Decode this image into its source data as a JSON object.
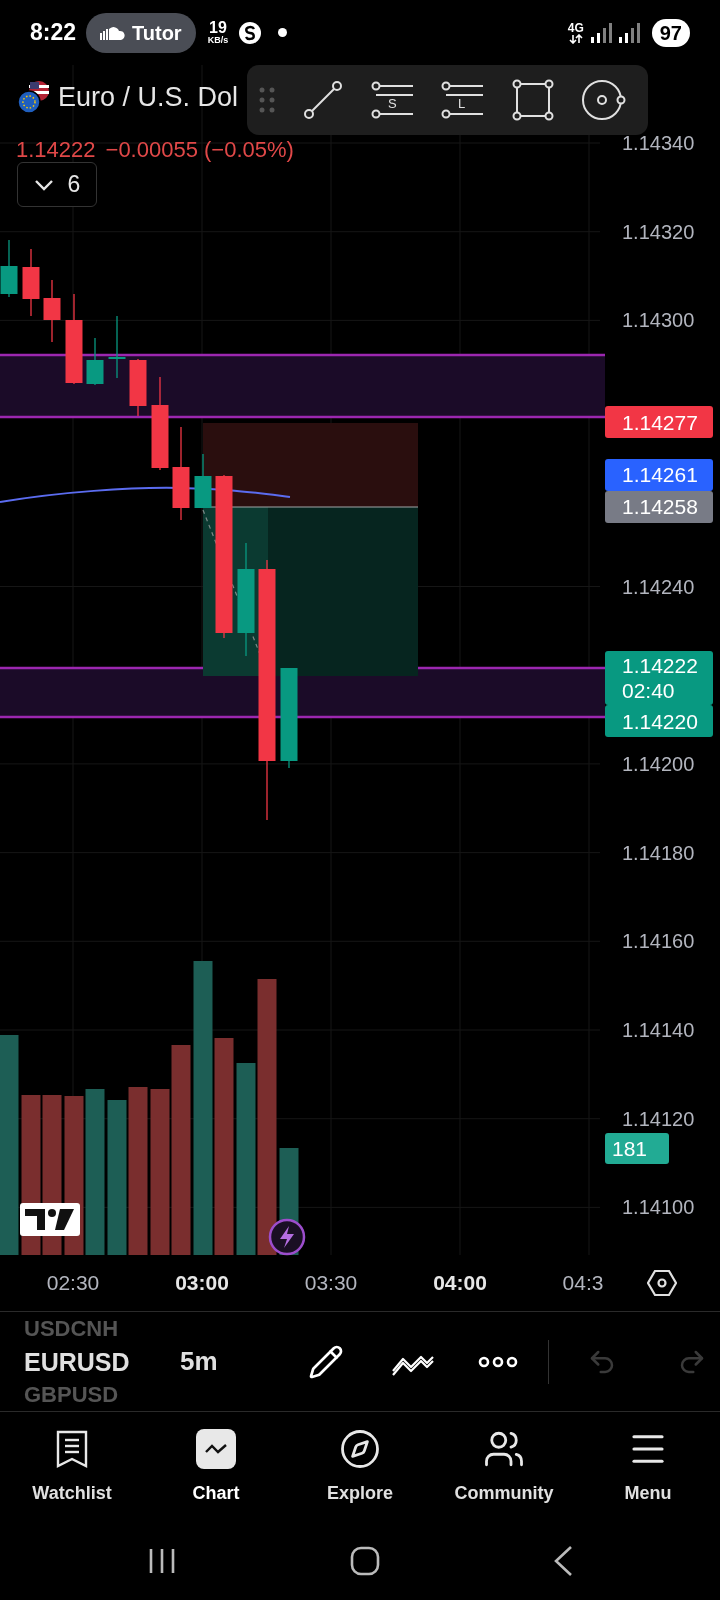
{
  "status_bar": {
    "time": "8:22",
    "pill": "Tutor",
    "speed_value": "19",
    "speed_unit": "KB/s",
    "network": "4G",
    "battery": "97"
  },
  "symbol": {
    "name": "Euro / U.S. Dol",
    "price": "1.14222",
    "change": "−0.00055 (−0.05%)"
  },
  "indicators_button": {
    "count": "6"
  },
  "drawing_toolbar": {
    "tools": [
      {
        "kind": "trend-line"
      },
      {
        "kind": "lines",
        "label": "S"
      },
      {
        "kind": "lines",
        "label": "L"
      },
      {
        "kind": "rectangle"
      },
      {
        "kind": "circle"
      }
    ]
  },
  "price_axis": {
    "ticks": [
      "1.14340",
      "1.14320",
      "1.14300",
      "1.14240",
      "1.14200",
      "1.14180",
      "1.14160",
      "1.14140",
      "1.14120",
      "1.14100"
    ]
  },
  "price_tags": [
    {
      "value": "1.14277",
      "color": "#f23645"
    },
    {
      "value": "1.14261",
      "color": "#2962ff"
    },
    {
      "value": "1.14258",
      "color": "#787b86"
    },
    {
      "value": "1.14222",
      "sub": "02:40",
      "color": "#089981"
    },
    {
      "value": "1.14220",
      "color": "#089981"
    }
  ],
  "volume_tag": {
    "value": "181",
    "color": "#22ab94"
  },
  "time_axis": [
    {
      "label": "02:30",
      "bold": false
    },
    {
      "label": "03:00",
      "bold": true
    },
    {
      "label": "03:30",
      "bold": false
    },
    {
      "label": "04:00",
      "bold": true
    },
    {
      "label": "04:3",
      "bold": false
    }
  ],
  "symbol_picker": {
    "previous": "USDCNH",
    "current": "EURUSD",
    "next": "GBPUSD"
  },
  "interval": "5m",
  "undo": {
    "disabled": true
  },
  "redo": {
    "disabled": true
  },
  "bottom_nav": [
    {
      "label": "Watchlist",
      "kind": "watchlist",
      "selected": false
    },
    {
      "label": "Chart",
      "kind": "chart",
      "selected": true
    },
    {
      "label": "Explore",
      "kind": "explore",
      "selected": false
    },
    {
      "label": "Community",
      "kind": "community",
      "selected": false
    },
    {
      "label": "Menu",
      "kind": "menu",
      "selected": false
    }
  ]
}
